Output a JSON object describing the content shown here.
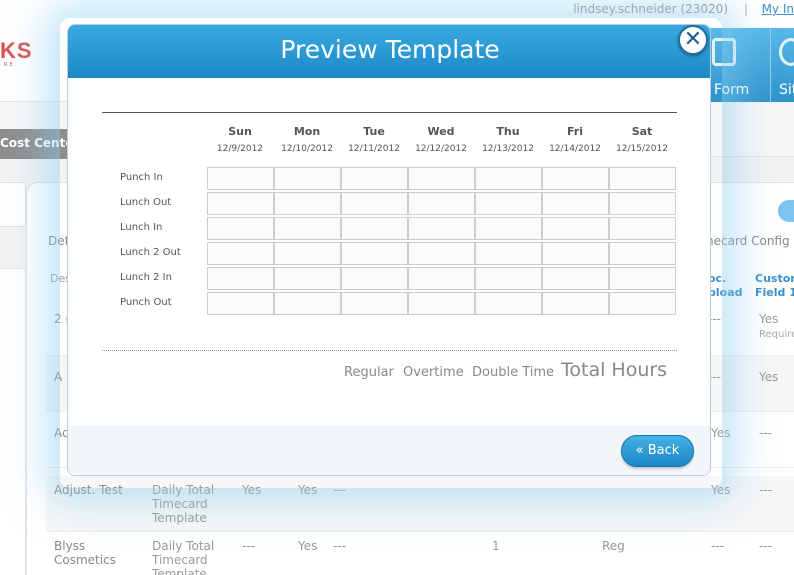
{
  "topbar": {
    "user": "lindsey.schneider (23020)",
    "separator": "|",
    "my_info": "My In"
  },
  "header": {
    "logo": "KS",
    "logo_sub": "RE",
    "nav": [
      {
        "label": "Form",
        "icon": "form-icon"
      },
      {
        "label": "Sit",
        "icon": "site-icon"
      }
    ]
  },
  "subbar": {
    "cost_center": "Cost Center"
  },
  "background": {
    "section_label": "Det",
    "timecard_config": "necard Config",
    "col_des": "Des",
    "col_doc_upload": "oc.\npload",
    "col_custom_field": "Custom\nField 1",
    "rows": [
      {
        "name": "2 (",
        "c1": "---",
        "c2": "Yes",
        "c3": "Require"
      },
      {
        "name": "A I",
        "c1": "---",
        "c2": "Yes"
      },
      {
        "name": "Ac",
        "c1": "Yes",
        "c2": "---"
      },
      {
        "name": "Adjust. Test",
        "template": "Daily Total Timecard Template",
        "v1": "Yes",
        "v2": "Yes",
        "dashes": "---",
        "c1": "Yes",
        "c2": "---"
      },
      {
        "name": "Blyss Cosmetics",
        "template": "Daily Total Timecard Template",
        "v1": "---",
        "v2": "Yes",
        "dashes": "---",
        "num": "1",
        "reg": "Reg",
        "c1": "---",
        "c2": "---"
      }
    ]
  },
  "modal": {
    "title": "Preview Template",
    "close_icon": "close-icon",
    "days": [
      {
        "name": "Sun",
        "date": "12/9/2012"
      },
      {
        "name": "Mon",
        "date": "12/10/2012"
      },
      {
        "name": "Tue",
        "date": "12/11/2012"
      },
      {
        "name": "Wed",
        "date": "12/12/2012"
      },
      {
        "name": "Thu",
        "date": "12/13/2012"
      },
      {
        "name": "Fri",
        "date": "12/14/2012"
      },
      {
        "name": "Sat",
        "date": "12/15/2012"
      }
    ],
    "rows": [
      "Punch In",
      "Lunch Out",
      "Lunch In",
      "Lunch 2 Out",
      "Lunch 2 In",
      "Punch Out"
    ],
    "summary": {
      "regular": "Regular",
      "overtime": "Overtime",
      "double_time": "Double Time",
      "total_hours": "Total Hours"
    },
    "back_button": "«  Back"
  }
}
